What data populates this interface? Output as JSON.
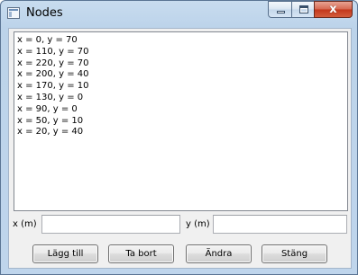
{
  "window": {
    "title": "Nodes",
    "caption_buttons": {
      "minimize": "minimize-icon",
      "maximize": "maximize-icon",
      "close": "close-icon",
      "close_glyph": "x"
    }
  },
  "nodes_list": [
    "x = 0, y = 70",
    "x = 110, y = 70",
    "x = 220, y = 70",
    "x = 200, y = 40",
    "x = 170, y = 10",
    "x = 130, y = 0",
    "x = 90, y = 0",
    "x = 50, y = 10",
    "x = 20, y = 40"
  ],
  "inputs": {
    "x_label": "x (m)",
    "x_value": "",
    "y_label": "y (m)",
    "y_value": ""
  },
  "buttons": {
    "add": "Lägg till",
    "remove": "Ta bort",
    "edit": "Ändra",
    "close": "Stäng"
  }
}
